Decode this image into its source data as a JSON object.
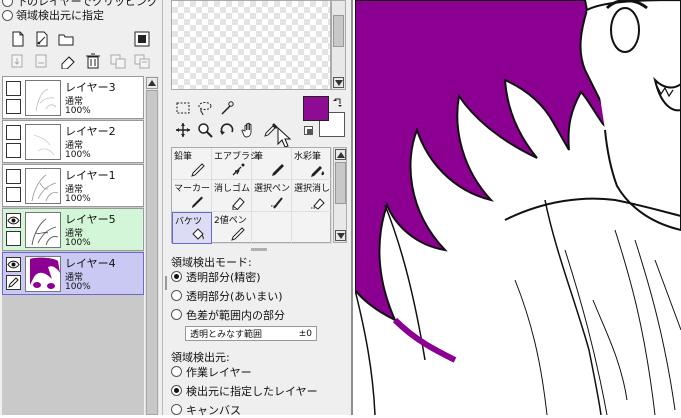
{
  "selection_source_top": {
    "option_cut_label": "下のレイヤーでクリッピング",
    "option_select_label": "領域検出元に指定"
  },
  "layer_toolbar": {
    "icons": [
      "new-layer-icon",
      "new-vector-layer-icon",
      "new-folder-icon",
      "mask-icon",
      "transfer-down-icon",
      "merge-down-icon",
      "clear-layer-icon",
      "delete-layer-icon",
      "combine-icon",
      "merge-visible-icon"
    ]
  },
  "layers": [
    {
      "name": "レイヤー3",
      "mode": "通常",
      "opacity": "100%",
      "visible": false,
      "state": "normal"
    },
    {
      "name": "レイヤー2",
      "mode": "通常",
      "opacity": "100%",
      "visible": false,
      "state": "normal"
    },
    {
      "name": "レイヤー1",
      "mode": "通常",
      "opacity": "100%",
      "visible": false,
      "state": "normal"
    },
    {
      "name": "レイヤー5",
      "mode": "通常",
      "opacity": "100%",
      "visible": true,
      "state": "source"
    },
    {
      "name": "レイヤー4",
      "mode": "通常",
      "opacity": "100%",
      "visible": true,
      "state": "selected"
    }
  ],
  "colors": {
    "foreground": "#8e0c93",
    "background": "#ffffff",
    "hair": "#8b0091",
    "source_layer": "#d4f6d8",
    "selected_layer": "#c9c9f4"
  },
  "tools": [
    "rect-select-icon",
    "lasso-icon",
    "magic-wand-icon",
    "move-icon",
    "zoom-icon",
    "rotate-icon",
    "hand-icon",
    "eyedropper-icon"
  ],
  "brushes": [
    {
      "name": "鉛筆",
      "icon": "pencil-icon"
    },
    {
      "name": "エアブラシ",
      "icon": "airbrush-icon"
    },
    {
      "name": "筆",
      "icon": "brush-icon"
    },
    {
      "name": "水彩筆",
      "icon": "watercolor-icon"
    },
    {
      "name": "マーカー",
      "icon": "marker-icon"
    },
    {
      "name": "消しゴム",
      "icon": "eraser-icon"
    },
    {
      "name": "選択ペン",
      "icon": "select-pen-icon"
    },
    {
      "name": "選択消し",
      "icon": "select-erase-icon"
    },
    {
      "name": "バケツ",
      "icon": "bucket-icon",
      "selected": true
    },
    {
      "name": "2値ペン",
      "icon": "binary-pen-icon"
    }
  ],
  "bucket_options": {
    "detect_mode_label": "領域検出モード:",
    "detect_modes": [
      "透明部分(精密)",
      "透明部分(あいまい)",
      "色差が範囲内の部分"
    ],
    "tolerance_label": "透明とみなす範囲",
    "tolerance_value": "±0",
    "detect_source_label": "領域検出元:",
    "detect_sources": [
      "作業レイヤー",
      "検出元に指定したレイヤー",
      "キャンバス"
    ]
  }
}
